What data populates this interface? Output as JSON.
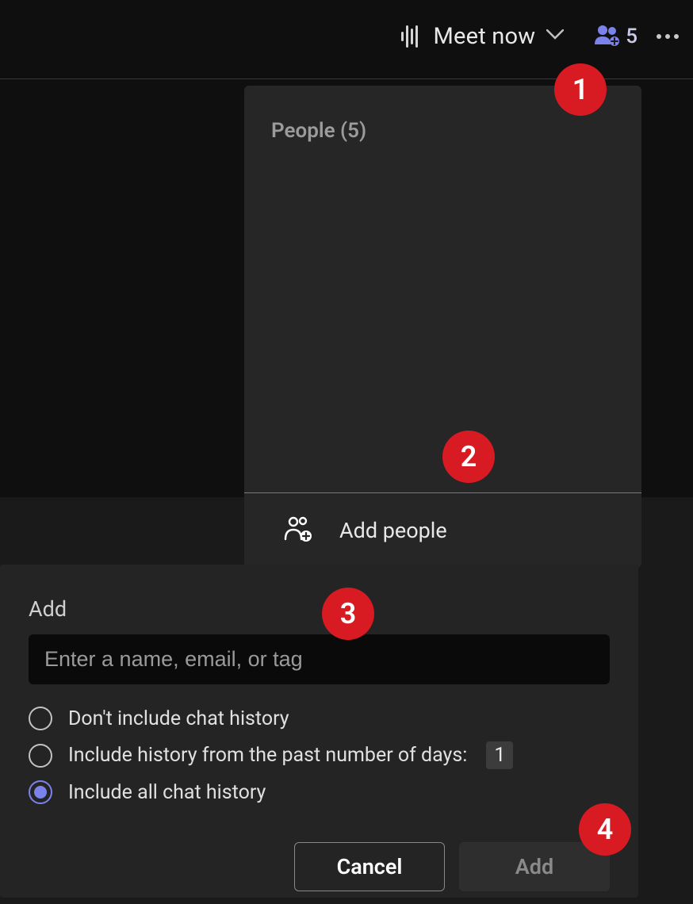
{
  "topbar": {
    "meet_now_label": "Meet now",
    "participants_count": "5"
  },
  "people_panel": {
    "header_label": "People (5)",
    "add_people_label": "Add people"
  },
  "add_dialog": {
    "title": "Add",
    "input_placeholder": "Enter a name, email, or tag",
    "options": {
      "no_history": "Don't include chat history",
      "days_history_prefix": "Include history from the past number of days:",
      "days_value": "1",
      "all_history": "Include all chat history"
    },
    "selected_option_index": 2,
    "buttons": {
      "cancel": "Cancel",
      "add": "Add"
    }
  },
  "annotations": {
    "m1": "1",
    "m2": "2",
    "m3": "3",
    "m4": "4"
  },
  "colors": {
    "accent": "#7b83eb",
    "panel_bg": "#262626",
    "dialog_bg": "#242424",
    "marker": "#d81b22"
  }
}
